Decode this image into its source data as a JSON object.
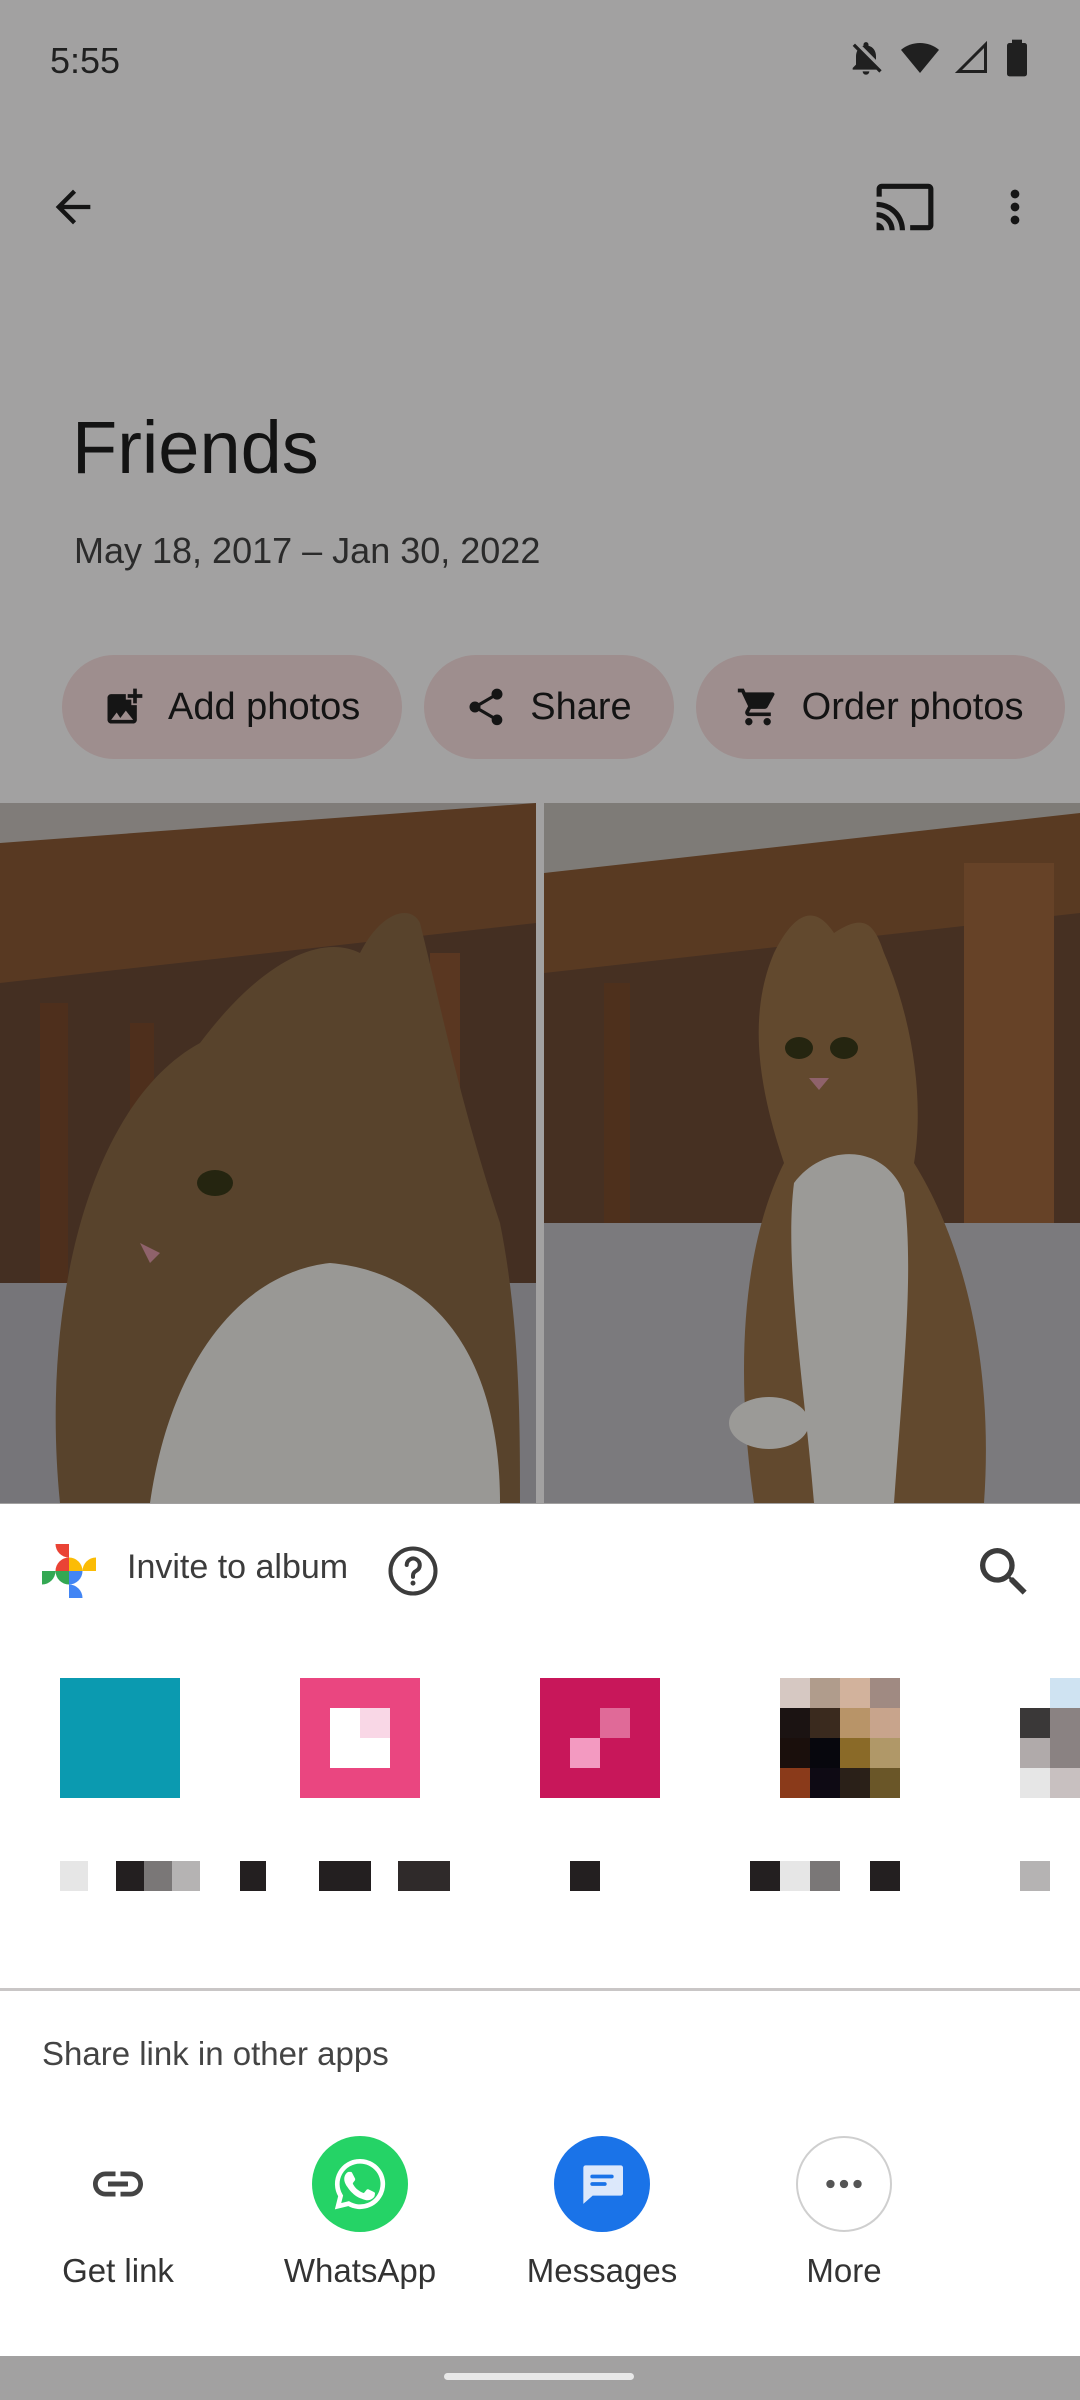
{
  "status_bar": {
    "time": "5:55",
    "icons": [
      "notifications-off-icon",
      "wifi-icon",
      "signal-icon",
      "battery-icon"
    ]
  },
  "top_bar": {
    "icons": [
      "back-arrow-icon",
      "cast-icon",
      "more-vert-icon"
    ]
  },
  "album": {
    "title": "Friends",
    "dates": "May 18, 2017 – Jan 30, 2022",
    "actions": [
      {
        "label": "Add photos",
        "icon": "add-photo-icon"
      },
      {
        "label": "Share",
        "icon": "share-icon"
      },
      {
        "label": "Order photos",
        "icon": "cart-icon"
      }
    ],
    "photos": [
      "cat photo 1",
      "cat photo 2"
    ]
  },
  "share_sheet": {
    "header": {
      "label": "Invite to album",
      "icons": [
        "google-photos-icon",
        "help-icon",
        "search-icon"
      ]
    },
    "section_label": "Share link in other apps",
    "apps": [
      {
        "label": "Get link",
        "icon": "link-icon"
      },
      {
        "label": "WhatsApp",
        "icon": "whatsapp-icon"
      },
      {
        "label": "Messages",
        "icon": "messages-icon"
      },
      {
        "label": "More",
        "icon": "more-horiz-icon"
      }
    ]
  },
  "colors": {
    "chip_background": "#f8dede",
    "scrim": "rgba(0,0,0,0.36)",
    "whatsapp_green": "#25d366",
    "messages_blue": "#1a73e8"
  }
}
